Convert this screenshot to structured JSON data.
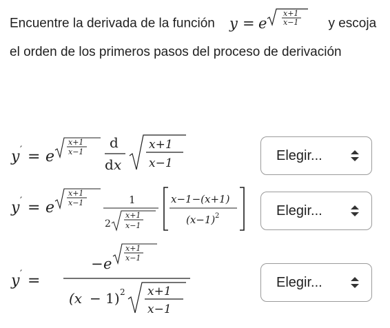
{
  "question": {
    "text_before": "Encuentre la derivada de la función",
    "text_after": "y escoja el orden de los primeros pasos del proceso de derivación"
  },
  "steps": [
    {
      "select_value": "Elegir..."
    },
    {
      "select_value": "Elegir..."
    },
    {
      "select_value": "Elegir..."
    }
  ],
  "icons": {
    "select_arrows": "up-down-chevron-icon"
  }
}
